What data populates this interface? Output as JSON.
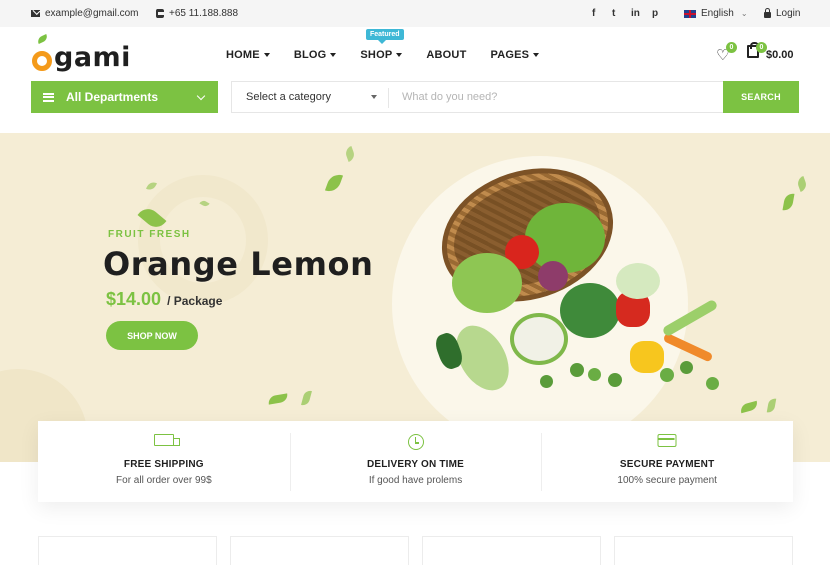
{
  "topbar": {
    "email": "example@gmail.com",
    "phone": "+65 11.188.888",
    "social": [
      "f",
      "t",
      "in",
      "p"
    ],
    "language": "English",
    "login": "Login"
  },
  "header": {
    "logo": "Ogami",
    "nav": [
      {
        "label": "HOME",
        "has_caret": true
      },
      {
        "label": "BLOG",
        "has_caret": true
      },
      {
        "label": "SHOP",
        "has_caret": true,
        "badge": "Featured"
      },
      {
        "label": "ABOUT",
        "has_caret": false
      },
      {
        "label": "PAGES",
        "has_caret": true
      }
    ],
    "wishlist_count": "0",
    "cart_count": "0",
    "cart_total": "$0.00"
  },
  "search": {
    "departments_label": "All Departments",
    "category_selected": "Select a category",
    "placeholder": "What do you need?",
    "button": "SEARCH"
  },
  "hero": {
    "tagline": "FRUIT FRESH",
    "title": "Orange Lemon",
    "price": "$14.00",
    "unit": "/ Package",
    "cta": "SHOP NOW"
  },
  "features": [
    {
      "icon": "truck-icon",
      "title": "FREE SHIPPING",
      "subtitle": "For all order over 99$"
    },
    {
      "icon": "clock-icon",
      "title": "DELIVERY ON TIME",
      "subtitle": "If good have prolems"
    },
    {
      "icon": "credit-card-icon",
      "title": "SECURE PAYMENT",
      "subtitle": "100% secure payment"
    }
  ],
  "colors": {
    "accent": "#7cc242",
    "hero_bg": "#f5edd5",
    "logo_orange": "#f49a1a",
    "featured_badge": "#3eb8d6"
  }
}
